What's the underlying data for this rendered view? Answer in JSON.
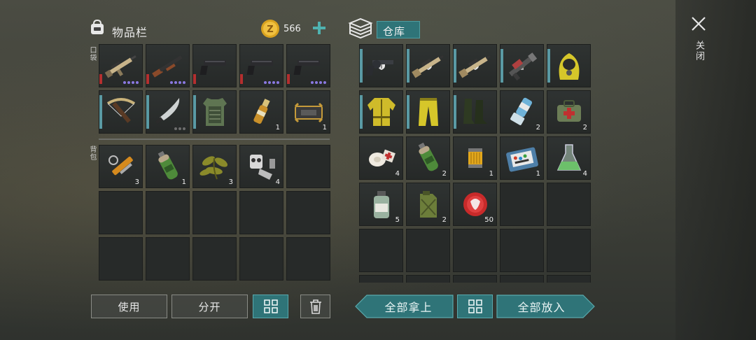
{
  "inventory": {
    "title": "物品栏",
    "currency_amount": "566",
    "currency_icon": "gold-coin-icon",
    "pocket_label": "口袋",
    "backpack_label": "背包",
    "pocket_items": [
      {
        "icon": "assault-rifle-icon",
        "rarity_dots": 4,
        "dot_color": "#8a78e0",
        "bar": "red"
      },
      {
        "icon": "shotgun-icon",
        "rarity_dots": 4,
        "dot_color": "#8a78e0",
        "bar": "red"
      },
      {
        "icon": "pistol-icon",
        "bar": "red"
      },
      {
        "icon": "pistol-icon",
        "rarity_dots": 4,
        "dot_color": "#8a78e0",
        "bar": "red"
      },
      {
        "icon": "pistol-icon",
        "rarity_dots": 4,
        "dot_color": "#8a78e0",
        "bar": "red"
      },
      {
        "icon": "crossbow-icon",
        "bar": "teal"
      },
      {
        "icon": "machete-icon",
        "rarity_dots": 3,
        "dot_color": "#6d6d6d",
        "bar": "teal"
      },
      {
        "icon": "body-armor-icon",
        "bar": "teal"
      },
      {
        "icon": "ampoule-icon",
        "count": "1"
      },
      {
        "icon": "bear-trap-icon",
        "count": "1"
      }
    ],
    "backpack_items": [
      {
        "icon": "hydraulic-parts-icon",
        "count": "3"
      },
      {
        "icon": "gas-canister-icon",
        "count": "1"
      },
      {
        "icon": "herb-icon",
        "count": "3"
      },
      {
        "icon": "machine-parts-icon",
        "count": "4"
      }
    ],
    "buttons": {
      "use": "使用",
      "split": "分开",
      "sort_icon": "grid-sort-icon",
      "trash_icon": "trash-icon"
    }
  },
  "storage": {
    "title": "仓库",
    "icon": "stacked-boxes-icon",
    "items": [
      {
        "icon": "revolver-icon",
        "badge": "shield-badge",
        "bar": "teal"
      },
      {
        "icon": "rifle-icon",
        "badge": "shield-badge",
        "bar": "teal"
      },
      {
        "icon": "rifle-icon",
        "badge": "shield-badge",
        "bar": "teal"
      },
      {
        "icon": "flamethrower-icon",
        "badge": "bulb-badge",
        "bar": "teal"
      },
      {
        "icon": "hazmat-hood-icon",
        "bar": "teal"
      },
      {
        "icon": "hazmat-jacket-icon",
        "bar": "teal"
      },
      {
        "icon": "hazmat-pants-icon",
        "bar": "teal"
      },
      {
        "icon": "rubber-boots-icon",
        "bar": "teal"
      },
      {
        "icon": "inhaler-icon",
        "count": "2"
      },
      {
        "icon": "medkit-bag-icon",
        "count": "2"
      },
      {
        "icon": "bandage-icon",
        "count": "4"
      },
      {
        "icon": "gas-canister-icon",
        "count": "2"
      },
      {
        "icon": "oil-filter-icon",
        "count": "1"
      },
      {
        "icon": "electronic-kit-icon",
        "count": "1"
      },
      {
        "icon": "chemical-flask-icon",
        "count": "4"
      },
      {
        "icon": "medicine-bottle-icon",
        "count": "5"
      },
      {
        "icon": "jerrycan-icon",
        "count": "2"
      },
      {
        "icon": "bottle-cap-icon",
        "count": "50"
      }
    ],
    "buttons": {
      "take_all": "全部拿上",
      "sort_icon": "grid-sort-icon",
      "put_all": "全部放入"
    }
  },
  "close": {
    "label": "关闭",
    "icon": "close-x-icon"
  },
  "colors": {
    "accent_teal": "#2f7478",
    "rarity_purple": "#8a78e0",
    "bar_red": "#b42f2f",
    "bar_teal": "#5a9aa4"
  }
}
